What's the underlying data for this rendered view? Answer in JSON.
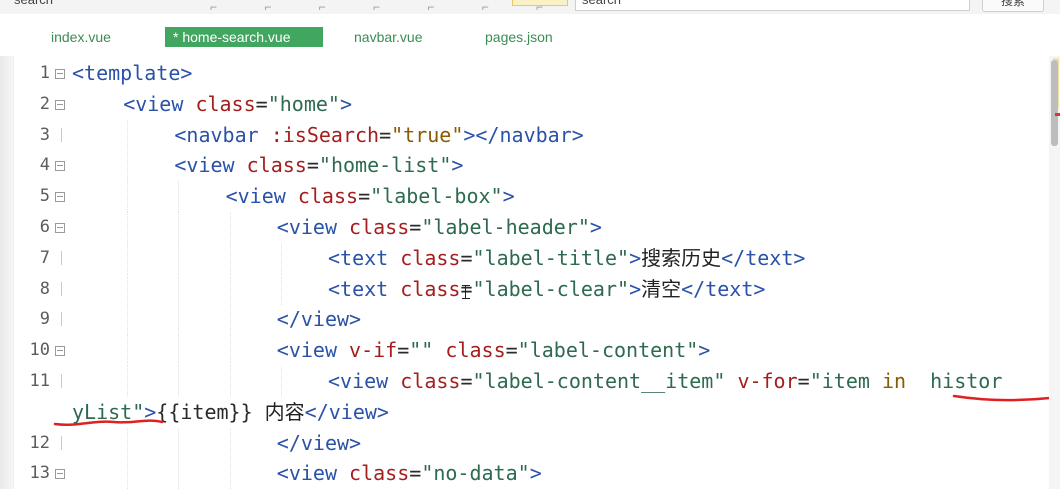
{
  "top": {
    "search_input_text": "search",
    "search_field_value": "search",
    "button_label": "搜索"
  },
  "tabs": [
    {
      "label": "index.vue",
      "active": false
    },
    {
      "label": "* home-search.vue",
      "active": true
    },
    {
      "label": "navbar.vue",
      "active": false
    },
    {
      "label": "pages.json",
      "active": false
    }
  ],
  "editor": {
    "lines": [
      {
        "number": "1",
        "tokens": [
          {
            "t": "tag",
            "v": "<template>"
          }
        ]
      },
      {
        "number": "2",
        "tokens": [
          {
            "t": "tag",
            "v": "<view "
          },
          {
            "t": "attr",
            "v": "class"
          },
          {
            "t": "plain",
            "v": "="
          },
          {
            "t": "str",
            "v": "\"home\""
          },
          {
            "t": "tag",
            "v": ">"
          }
        ]
      },
      {
        "number": "3",
        "tokens": [
          {
            "t": "tag",
            "v": "<navbar "
          },
          {
            "t": "attr",
            "v": ":isSearch"
          },
          {
            "t": "plain",
            "v": "="
          },
          {
            "t": "kw",
            "v": "\"true\""
          },
          {
            "t": "tag",
            "v": "></navbar>"
          }
        ]
      },
      {
        "number": "4",
        "tokens": [
          {
            "t": "tag",
            "v": "<view "
          },
          {
            "t": "attr",
            "v": "class"
          },
          {
            "t": "plain",
            "v": "="
          },
          {
            "t": "str",
            "v": "\"home-list\""
          },
          {
            "t": "tag",
            "v": ">"
          }
        ]
      },
      {
        "number": "5",
        "tokens": [
          {
            "t": "tag",
            "v": "<view "
          },
          {
            "t": "attr",
            "v": "class"
          },
          {
            "t": "plain",
            "v": "="
          },
          {
            "t": "str",
            "v": "\"label-box\""
          },
          {
            "t": "tag",
            "v": ">"
          }
        ]
      },
      {
        "number": "6",
        "tokens": [
          {
            "t": "tag",
            "v": "<view "
          },
          {
            "t": "attr",
            "v": "class"
          },
          {
            "t": "plain",
            "v": "="
          },
          {
            "t": "str",
            "v": "\"label-header\""
          },
          {
            "t": "tag",
            "v": ">"
          }
        ]
      },
      {
        "number": "7",
        "tokens": [
          {
            "t": "tag",
            "v": "<text "
          },
          {
            "t": "attr",
            "v": "class"
          },
          {
            "t": "plain",
            "v": "="
          },
          {
            "t": "str",
            "v": "\"label-title\""
          },
          {
            "t": "tag",
            "v": ">"
          },
          {
            "t": "cjk",
            "v": "搜索历史"
          },
          {
            "t": "tag",
            "v": "</text>"
          }
        ]
      },
      {
        "number": "8",
        "tokens": [
          {
            "t": "tag",
            "v": "<text "
          },
          {
            "t": "attr",
            "v": "class"
          },
          {
            "t": "plain",
            "v": "="
          },
          {
            "t": "str",
            "v": "\"label-clear\""
          },
          {
            "t": "tag",
            "v": ">"
          },
          {
            "t": "cjk",
            "v": "清空"
          },
          {
            "t": "tag",
            "v": "</text>"
          }
        ]
      },
      {
        "number": "9",
        "tokens": [
          {
            "t": "tag",
            "v": "</view>"
          }
        ]
      },
      {
        "number": "10",
        "tokens": [
          {
            "t": "tag",
            "v": "<view "
          },
          {
            "t": "attr",
            "v": "v-if"
          },
          {
            "t": "plain",
            "v": "="
          },
          {
            "t": "str",
            "v": "\"\""
          },
          {
            "t": "plain",
            "v": " "
          },
          {
            "t": "attr",
            "v": "class"
          },
          {
            "t": "plain",
            "v": "="
          },
          {
            "t": "str",
            "v": "\"label-content\""
          },
          {
            "t": "tag",
            "v": ">"
          }
        ]
      },
      {
        "number": "11",
        "tokens": [
          {
            "t": "tag",
            "v": "<view "
          },
          {
            "t": "attr",
            "v": "class"
          },
          {
            "t": "plain",
            "v": "="
          },
          {
            "t": "str",
            "v": "\"label-content__item\""
          },
          {
            "t": "plain",
            "v": " "
          },
          {
            "t": "attr",
            "v": "v-for"
          },
          {
            "t": "plain",
            "v": "="
          },
          {
            "t": "str",
            "v": "\"item "
          },
          {
            "t": "kw",
            "v": "in"
          },
          {
            "t": "str",
            "v": "  histor"
          }
        ]
      },
      {
        "number": "",
        "tokens": [
          {
            "t": "str",
            "v": "yList\""
          },
          {
            "t": "tag",
            "v": ">"
          },
          {
            "t": "plain",
            "v": "{{item}} "
          },
          {
            "t": "cjk",
            "v": "内容"
          },
          {
            "t": "tag",
            "v": "</view>"
          }
        ]
      },
      {
        "number": "12",
        "tokens": [
          {
            "t": "tag",
            "v": "</view>"
          }
        ]
      },
      {
        "number": "13",
        "tokens": [
          {
            "t": "tag",
            "v": "<view "
          },
          {
            "t": "attr",
            "v": "class"
          },
          {
            "t": "plain",
            "v": "="
          },
          {
            "t": "str",
            "v": "\"no-data\""
          },
          {
            "t": "tag",
            "v": ">"
          }
        ]
      }
    ]
  },
  "colors": {
    "tag": "#2a52a8",
    "attribute": "#a51e1e",
    "string": "#2d6a4f",
    "active_tab": "#41a660",
    "annotation": "#e02020"
  }
}
